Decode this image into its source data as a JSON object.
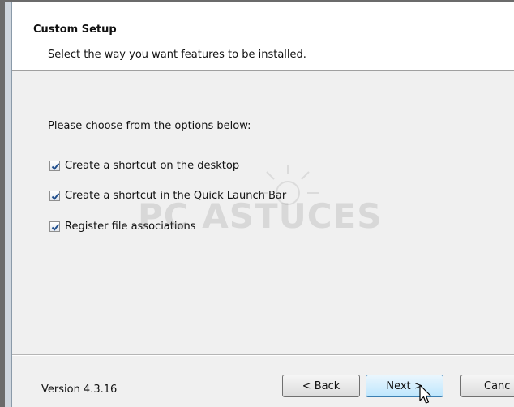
{
  "header": {
    "title": "Custom Setup",
    "subtitle": "Select the way you want features to be installed."
  },
  "body": {
    "prompt": "Please choose from the options below:",
    "options": [
      {
        "label": "Create a shortcut on the desktop",
        "checked": true
      },
      {
        "label": "Create a shortcut in the Quick Launch Bar",
        "checked": true
      },
      {
        "label": "Register file associations",
        "checked": true
      }
    ]
  },
  "watermark": "PC ASTUCES",
  "footer": {
    "version": "Version 4.3.16",
    "back_label": "< Back",
    "next_label": "Next >",
    "cancel_label": "Canc"
  },
  "colors": {
    "header_bg": "#ffffff",
    "dialog_bg": "#f0f0f0",
    "checkmark": "#1f4e8c",
    "next_button_border": "#3c7fb1"
  }
}
